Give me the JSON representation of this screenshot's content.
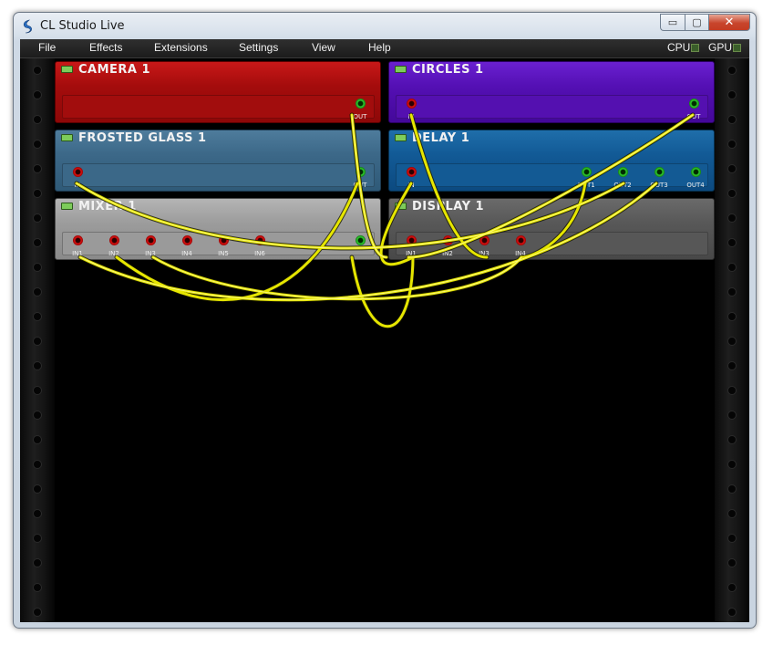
{
  "window": {
    "title": "CL Studio Live",
    "min_glyph": "▭",
    "max_glyph": "▢",
    "close_glyph": "✕"
  },
  "menu": [
    "File",
    "Effects",
    "Extensions",
    "Settings",
    "View",
    "Help"
  ],
  "meters": {
    "cpu": "CPU",
    "gpu": "GPU"
  },
  "colors": {
    "camera": "#b40f0f",
    "circles": "#5a10b8",
    "frosted": "#3d6a88",
    "delay": "#125a96",
    "mixer": "#9a9a9a",
    "display": "#585858",
    "cable": "#e6e600"
  },
  "modules": {
    "camera": {
      "title": "CAMERA 1",
      "outputs": [
        "OUT"
      ]
    },
    "circles": {
      "title": "CIRCLES 1",
      "inputs": [
        "IN"
      ],
      "outputs": [
        "OUT"
      ]
    },
    "frosted": {
      "title": "FROSTED GLASS 1",
      "inputs": [
        "IN"
      ],
      "outputs": [
        "OUT"
      ]
    },
    "delay": {
      "title": "DELAY 1",
      "inputs": [
        "IN"
      ],
      "outputs": [
        "OUT1",
        "OUT2",
        "OUT3",
        "OUT4"
      ]
    },
    "mixer": {
      "title": "MIXER 1",
      "inputs": [
        "IN1",
        "IN2",
        "IN3",
        "IN4",
        "IN5",
        "IN6"
      ],
      "outputs": [
        "OUT"
      ]
    },
    "display": {
      "title": "DISPLAY 1",
      "inputs": [
        "IN1",
        "IN2",
        "IN3",
        "IN4"
      ]
    }
  }
}
